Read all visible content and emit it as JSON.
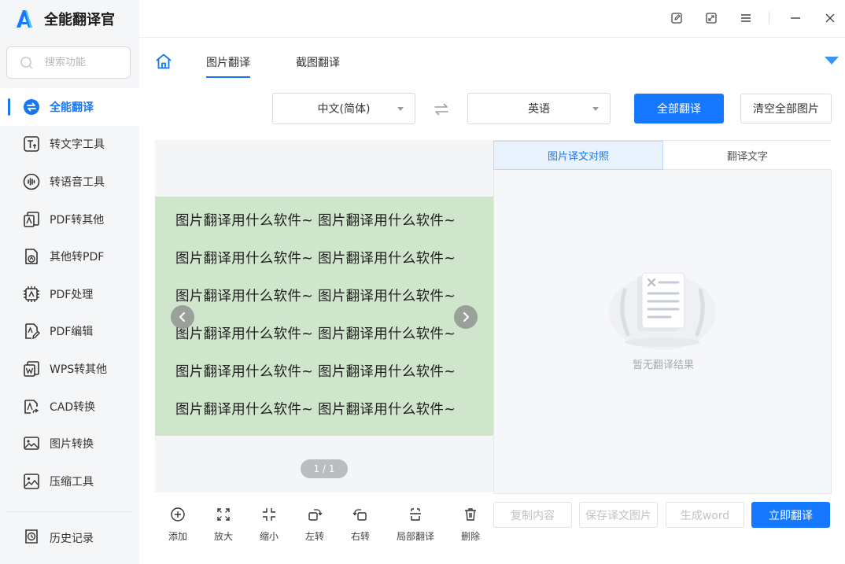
{
  "app": {
    "name": "全能翻译官"
  },
  "sidebar": {
    "search_placeholder": "搜索功能",
    "items": [
      {
        "label": "全能翻译",
        "icon": "translate-icon",
        "active": true
      },
      {
        "label": "转文字工具",
        "icon": "text-convert-icon"
      },
      {
        "label": "转语音工具",
        "icon": "voice-icon"
      },
      {
        "label": "PDF转其他",
        "icon": "pdf-export-icon"
      },
      {
        "label": "其他转PDF",
        "icon": "pdf-import-icon"
      },
      {
        "label": "PDF处理",
        "icon": "pdf-process-icon"
      },
      {
        "label": "PDF编辑",
        "icon": "pdf-edit-icon"
      },
      {
        "label": "WPS转其他",
        "icon": "wps-icon"
      },
      {
        "label": "CAD转换",
        "icon": "cad-icon"
      },
      {
        "label": "图片转换",
        "icon": "image-convert-icon"
      },
      {
        "label": "压缩工具",
        "icon": "compress-icon"
      }
    ],
    "history_label": "历史记录"
  },
  "tabs": [
    {
      "label": "图片翻译",
      "active": true
    },
    {
      "label": "截图翻译",
      "active": false
    }
  ],
  "lang_bar": {
    "source": "中文(简体)",
    "target": "英语",
    "translate_all": "全部翻译",
    "clear_all": "清空全部图片"
  },
  "preview": {
    "lines": [
      "图片翻译用什么软件~ 图片翻译用什么软件~",
      "图片翻译用什么软件~ 图片翻译用什么软件~",
      "图片翻译用什么软件~ 图片翻译用什么软件~",
      "图片翻译用什么软件~ 图片翻译用什么软件~",
      "图片翻译用什么软件~ 图片翻译用什么软件~",
      "图片翻译用什么软件~ 图片翻译用什么软件~"
    ],
    "page_indicator": "1 / 1"
  },
  "toolbar": {
    "add": "添加",
    "zoom_in": "放大",
    "zoom_out": "缩小",
    "rotate_left": "左转",
    "rotate_right": "右转",
    "partial_translate": "局部翻译",
    "delete": "删除"
  },
  "result": {
    "tab_compare": "图片译文对照",
    "tab_text": "翻译文字",
    "empty_text": "暂无翻译结果",
    "copy_content": "复制内容",
    "save_image": "保存译文图片",
    "generate_word": "生成word",
    "translate_now": "立即翻译"
  },
  "colors": {
    "accent": "#1677ff",
    "image_bg": "#cfe5cc",
    "sidebar_bg": "#f5f6f8"
  }
}
